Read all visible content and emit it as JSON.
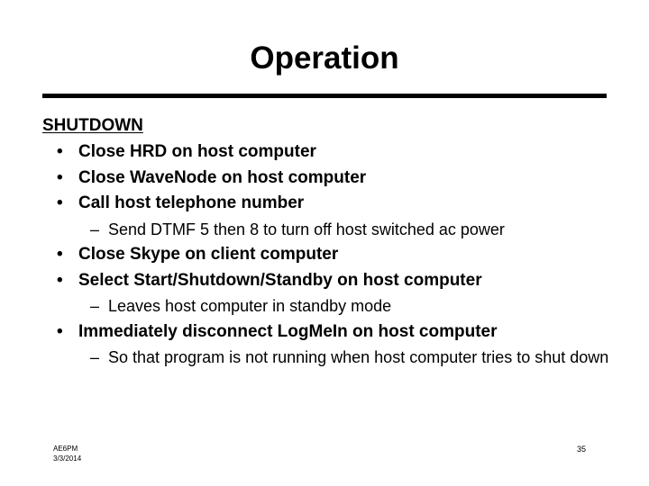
{
  "slide": {
    "title": "Operation",
    "section_heading": "SHUTDOWN",
    "bullets": [
      {
        "level": 1,
        "marker": "•",
        "text": "Close HRD on host computer"
      },
      {
        "level": 1,
        "marker": "•",
        "text": "Close WaveNode on host computer"
      },
      {
        "level": 1,
        "marker": "•",
        "text": "Call host telephone number"
      },
      {
        "level": 2,
        "marker": "–",
        "text": "Send DTMF 5 then 8 to turn off host switched ac power"
      },
      {
        "level": 1,
        "marker": "•",
        "text": "Close Skype on client computer"
      },
      {
        "level": 1,
        "marker": "•",
        "text": "Select Start/Shutdown/Standby on host computer"
      },
      {
        "level": 2,
        "marker": "–",
        "text": "Leaves host computer in standby mode"
      },
      {
        "level": 1,
        "marker": "•",
        "text": "Immediately disconnect LogMeIn on host computer"
      },
      {
        "level": 2,
        "marker": "–",
        "text": "So that program is not running when host computer tries to shut down"
      }
    ],
    "footer": {
      "callsign": "AE6PM",
      "date": "3/3/2014",
      "page_number": "35"
    },
    "colors": {
      "background": "#ffffff",
      "text": "#000000",
      "rule": "#000000"
    }
  }
}
